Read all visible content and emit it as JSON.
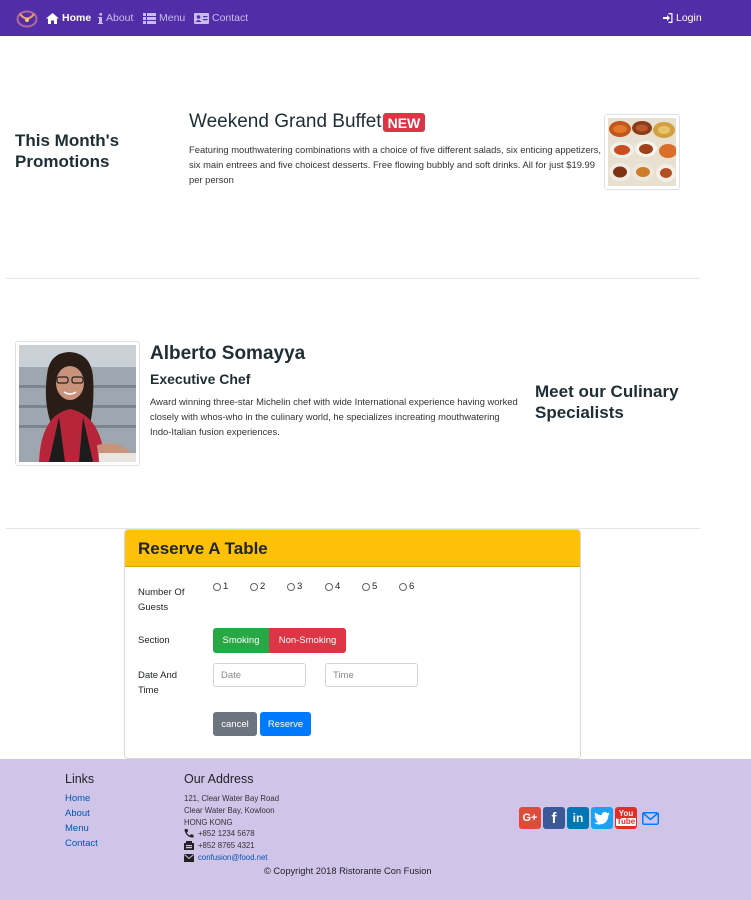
{
  "navbar": {
    "items": [
      {
        "label": "Home",
        "icon": "home-icon"
      },
      {
        "label": "About",
        "icon": "info-icon"
      },
      {
        "label": "Menu",
        "icon": "list-icon"
      },
      {
        "label": "Contact",
        "icon": "address-card-icon"
      }
    ],
    "login_label": "Login",
    "bg_color": "#512da8"
  },
  "promotion": {
    "section_heading": "This Month's Promotions",
    "title": "Weekend Grand Buffet",
    "badge": "NEW",
    "description": "Featuring mouthwatering combinations with a choice of five different salads, six enticing appetizers, six main entrees and five choicest desserts. Free flowing bubbly and soft drinks. All for just $19.99 per person"
  },
  "leader": {
    "name": "Alberto Somayya",
    "designation": "Executive Chef",
    "description": "Award winning three-star Michelin chef with wide International experience having worked closely with whos-who in the culinary world, he specializes increating mouthwatering Indo-Italian fusion experiences.",
    "section_heading": "Meet our Culinary Specialists"
  },
  "reserve": {
    "title": "Reserve A Table",
    "guests_label": "Number Of Guests",
    "guest_options": [
      "1",
      "2",
      "3",
      "4",
      "5",
      "6"
    ],
    "section_label": "Section",
    "smoking_label": "Smoking",
    "nonsmoking_label": "Non-Smoking",
    "datetime_label": "Date And Time",
    "date_placeholder": "Date",
    "time_placeholder": "Time",
    "cancel_label": "cancel",
    "reserve_label": "Reserve"
  },
  "footer": {
    "links_heading": "Links",
    "links": [
      "Home",
      "About",
      "Menu",
      "Contact"
    ],
    "address_heading": "Our Address",
    "address_lines": [
      "121, Clear Water Bay Road",
      "Clear Water Bay, Kowloon",
      "HONG KONG"
    ],
    "phone": "+852 1234 5678",
    "fax": "+852 8765 4321",
    "email": "confusion@food.net",
    "social": [
      {
        "name": "google-plus",
        "color": "#dd4b39"
      },
      {
        "name": "facebook",
        "color": "#3b5998"
      },
      {
        "name": "linkedin",
        "color": "#0077b5"
      },
      {
        "name": "twitter",
        "color": "#1da1f2"
      },
      {
        "name": "youtube",
        "color": "#e52d27"
      },
      {
        "name": "mail",
        "color": "#007bff"
      }
    ],
    "copyright": "© Copyright 2018 Ristorante Con Fusion"
  }
}
